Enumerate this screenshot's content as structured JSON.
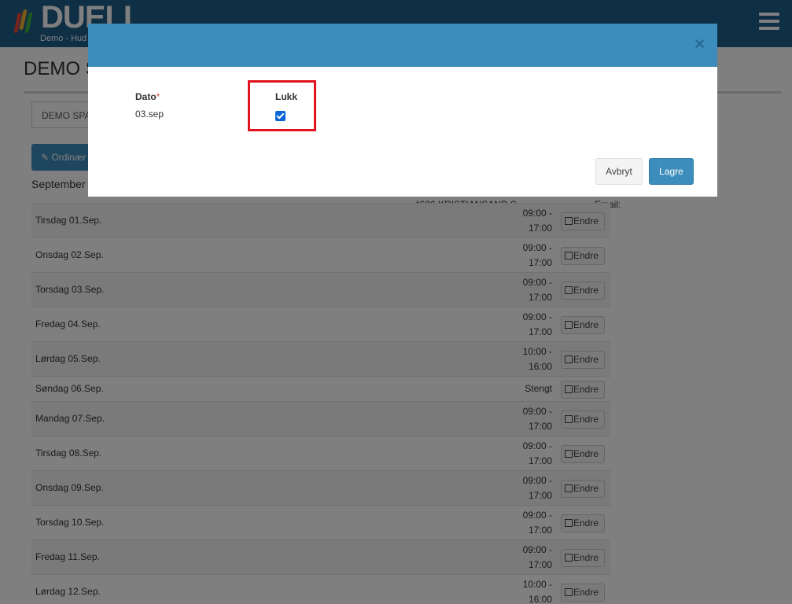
{
  "app": {
    "logo_text": "DUELL",
    "logo_sub": "Demo - Hud",
    "colors": {
      "header": "#1f5f8b",
      "primary": "#3c8dbc",
      "highlight": "#e0141e"
    }
  },
  "page": {
    "title": "DEMO S",
    "store_select": "DEMO SPA",
    "ordinary_button": "Ordinær",
    "month_label": "September",
    "address": "4626 KRISTIANSAND S",
    "email_label": "Email:",
    "edit_label": "Endre",
    "schedule": [
      {
        "day": "Tirsdag 01.Sep.",
        "open": "09:00 -",
        "close": "17:00"
      },
      {
        "day": "Onsdag 02.Sep.",
        "open": "09:00 -",
        "close": "17:00"
      },
      {
        "day": "Torsdag 03.Sep.",
        "open": "09:00 -",
        "close": "17:00"
      },
      {
        "day": "Fredag 04.Sep.",
        "open": "09:00 -",
        "close": "17:00"
      },
      {
        "day": "Lørdag 05.Sep.",
        "open": "10:00 -",
        "close": "16:00"
      },
      {
        "day": "Søndag 06.Sep.",
        "open": "Stengt",
        "close": ""
      },
      {
        "day": "Mandag 07.Sep.",
        "open": "09:00 -",
        "close": "17:00"
      },
      {
        "day": "Tirsdag 08.Sep.",
        "open": "09:00 -",
        "close": "17:00"
      },
      {
        "day": "Onsdag 09.Sep.",
        "open": "09:00 -",
        "close": "17:00"
      },
      {
        "day": "Torsdag 10.Sep.",
        "open": "09:00 -",
        "close": "17:00"
      },
      {
        "day": "Fredag 11.Sep.",
        "open": "09:00 -",
        "close": "17:00"
      },
      {
        "day": "Lørdag 12.Sep.",
        "open": "10:00 -",
        "close": "16:00"
      }
    ]
  },
  "modal": {
    "close_symbol": "×",
    "date_label": "Dato",
    "required_mark": "*",
    "date_value": "03.sep",
    "close_label": "Lukk",
    "close_checked": true,
    "cancel_label": "Avbryt",
    "save_label": "Lagre"
  }
}
